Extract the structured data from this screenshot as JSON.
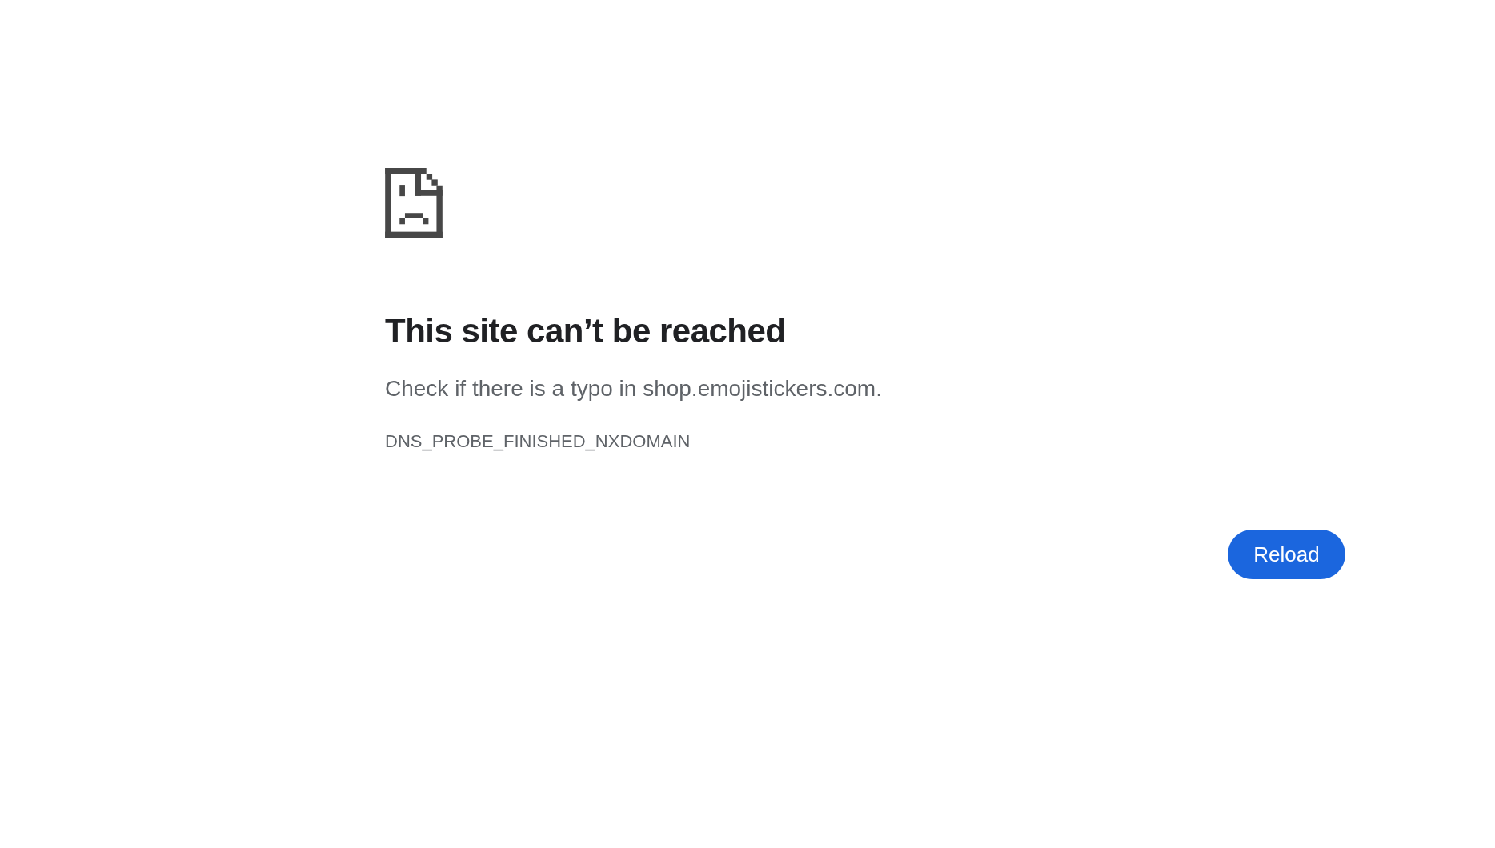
{
  "heading": "This site can’t be reached",
  "message": "Check if there is a typo in shop.emojistickers.com.",
  "error_code": "DNS_PROBE_FINISHED_NXDOMAIN",
  "buttons": [
    "Reload"
  ]
}
